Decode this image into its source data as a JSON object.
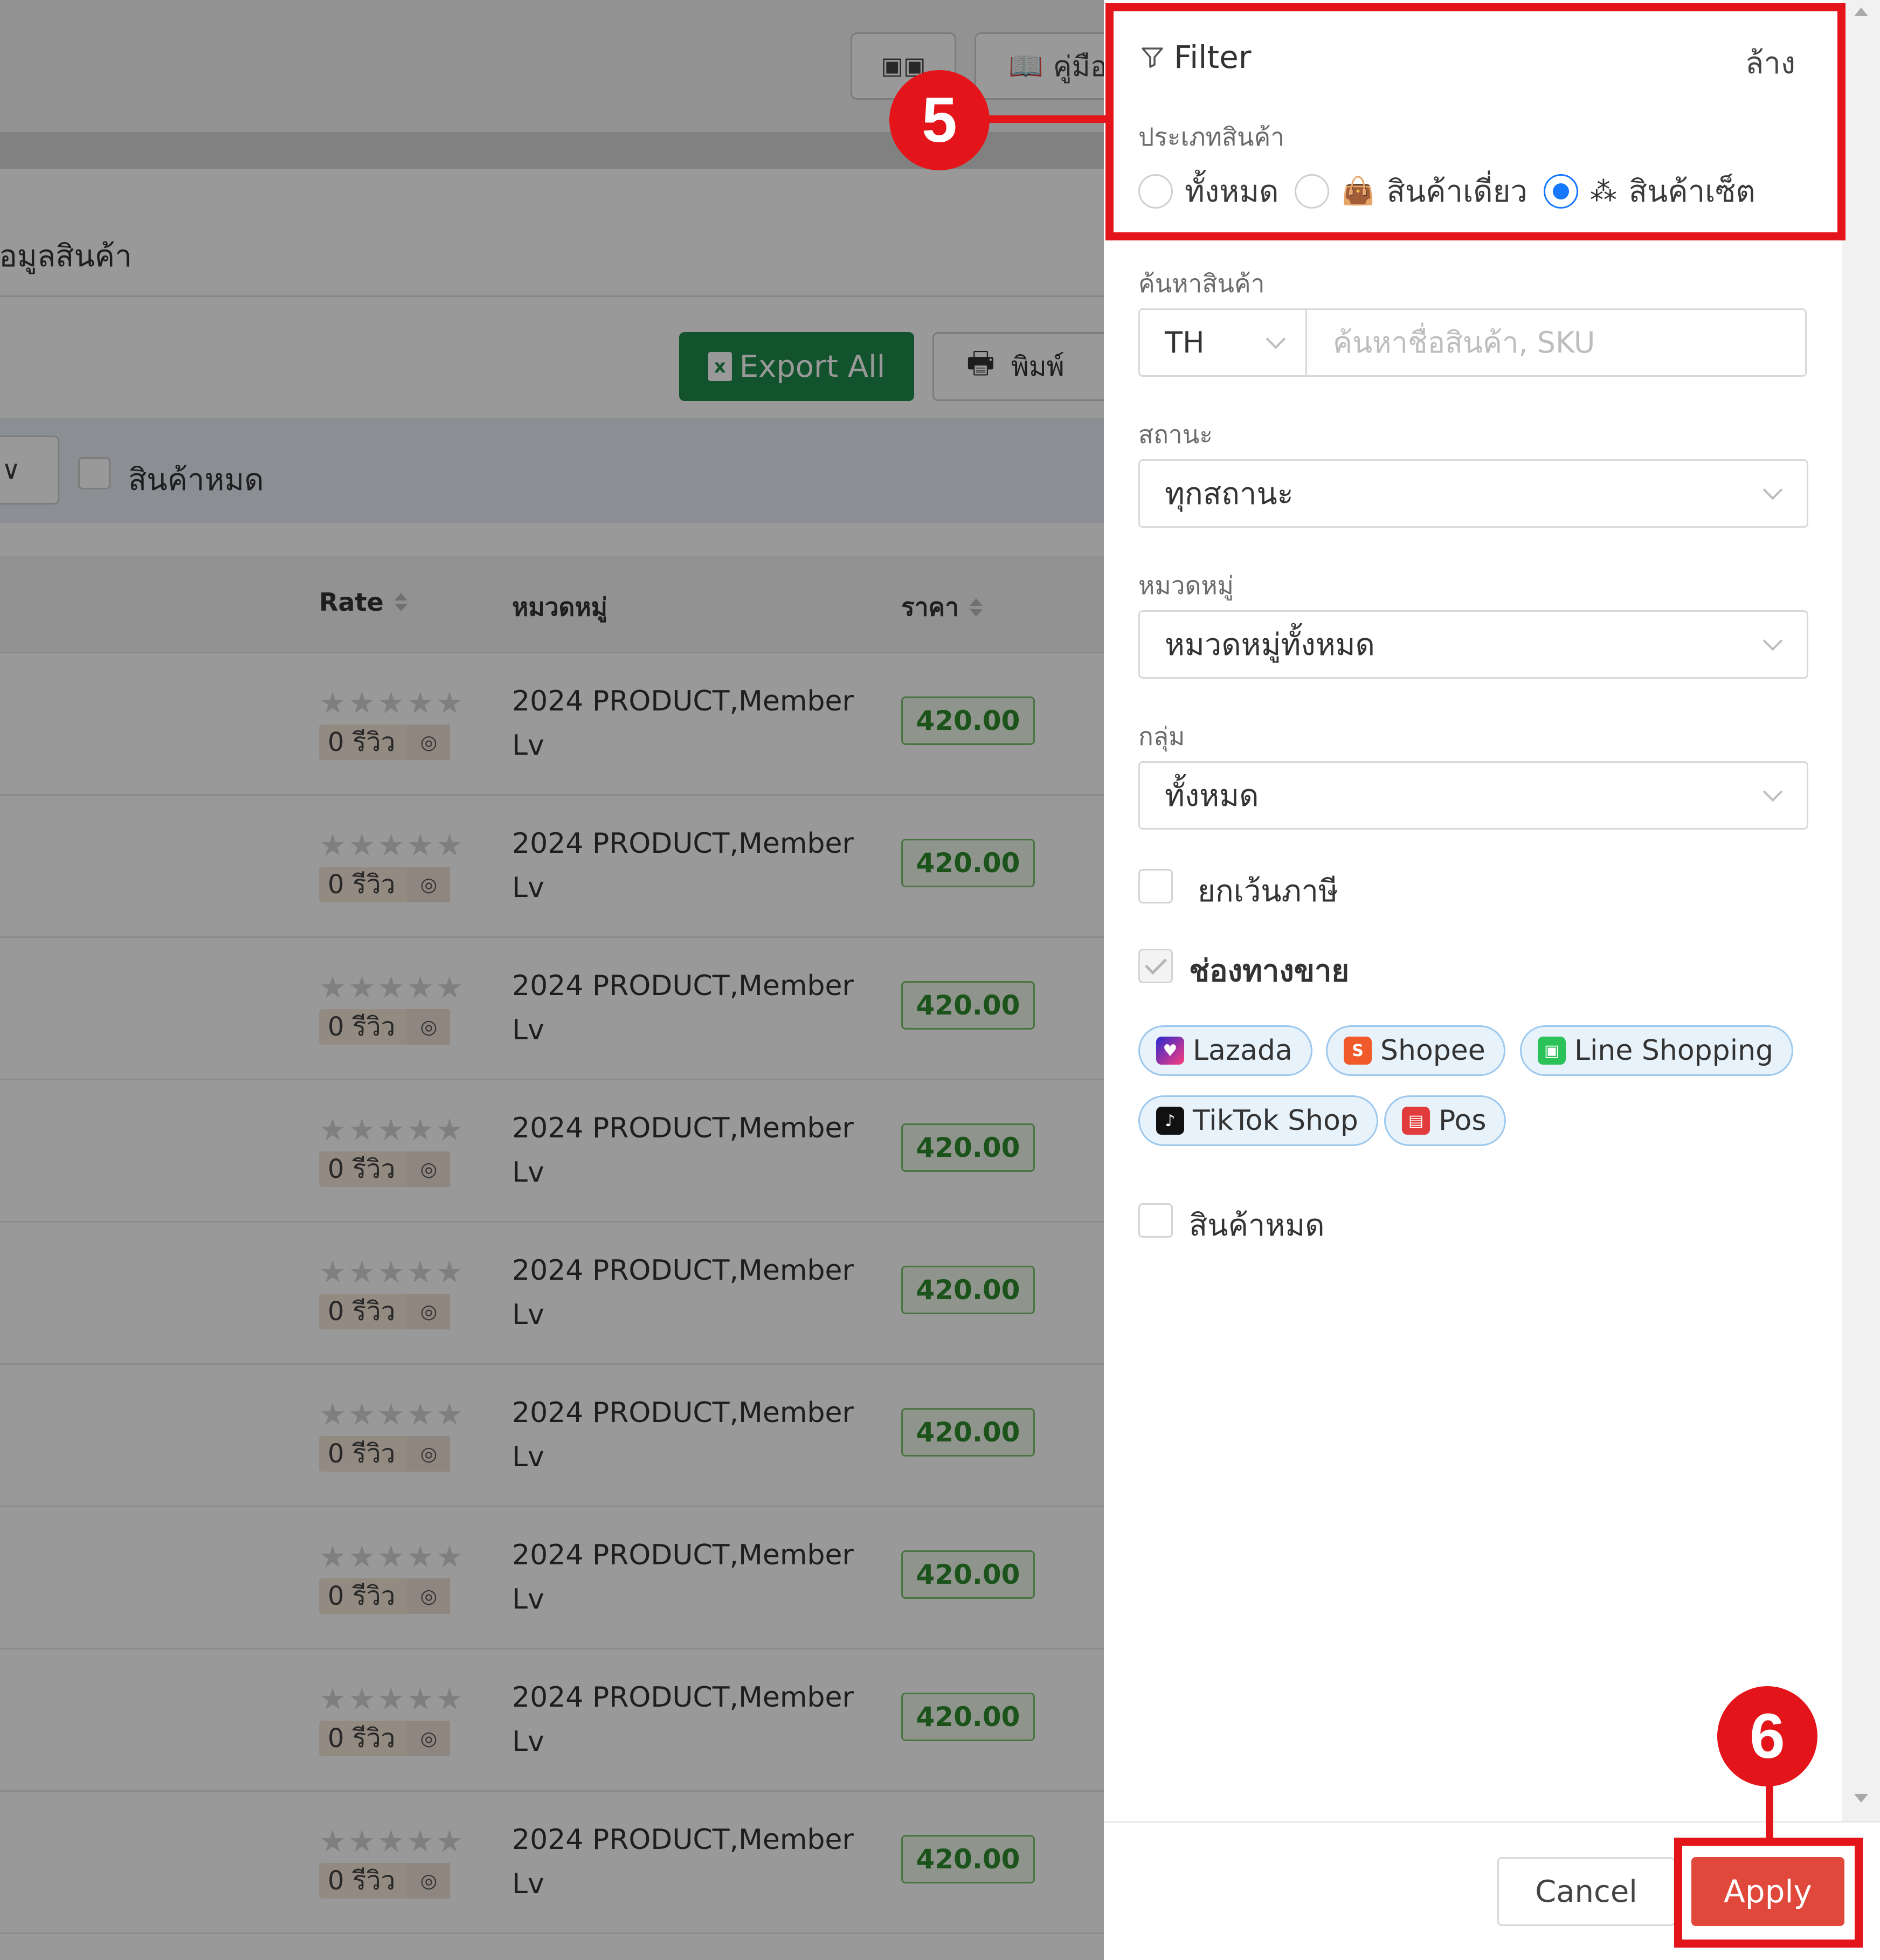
{
  "background": {
    "top_buttons": {
      "btn1_label": "",
      "guide_label": "คู่มือ"
    },
    "section_title": "ข้อมูลสินค้า",
    "export_label": "Export All",
    "print_label": "พิมพ์",
    "out_of_stock_label": "สินค้าหมด",
    "table_headers": {
      "rate": "Rate",
      "category": "หมวดหมู่",
      "price": "ราคา"
    },
    "rows": [
      {
        "reviews": "0 รีวิว",
        "category_line1": "2024 PRODUCT,Member",
        "category_line2": "Lv",
        "price": "420.00"
      },
      {
        "reviews": "0 รีวิว",
        "category_line1": "2024 PRODUCT,Member",
        "category_line2": "Lv",
        "price": "420.00"
      },
      {
        "reviews": "0 รีวิว",
        "category_line1": "2024 PRODUCT,Member",
        "category_line2": "Lv",
        "price": "420.00"
      },
      {
        "reviews": "0 รีวิว",
        "category_line1": "2024 PRODUCT,Member",
        "category_line2": "Lv",
        "price": "420.00"
      },
      {
        "reviews": "0 รีวิว",
        "category_line1": "2024 PRODUCT,Member",
        "category_line2": "Lv",
        "price": "420.00"
      },
      {
        "reviews": "0 รีวิว",
        "category_line1": "2024 PRODUCT,Member",
        "category_line2": "Lv",
        "price": "420.00"
      },
      {
        "reviews": "0 รีวิว",
        "category_line1": "2024 PRODUCT,Member",
        "category_line2": "Lv",
        "price": "420.00"
      },
      {
        "reviews": "0 รีวิว",
        "category_line1": "2024 PRODUCT,Member",
        "category_line2": "Lv",
        "price": "420.00"
      },
      {
        "reviews": "0 รีวิว",
        "category_line1": "2024 PRODUCT,Member",
        "category_line2": "Lv",
        "price": "420.00"
      }
    ]
  },
  "filter": {
    "title": "Filter",
    "clear_label": "ล้าง",
    "product_type": {
      "label": "ประเภทสินค้า",
      "options": [
        "ทั้งหมด",
        "สินค้าเดี่ยว",
        "สินค้าเซ็ต"
      ],
      "selected": "สินค้าเซ็ต"
    },
    "search": {
      "label": "ค้นหาสินค้า",
      "language": "TH",
      "placeholder": "ค้นหาชื่อสินค้า, SKU",
      "value": ""
    },
    "status": {
      "label": "สถานะ",
      "value": "ทุกสถานะ"
    },
    "category": {
      "label": "หมวดหมู่",
      "value": "หมวดหมู่ทั้งหมด"
    },
    "group": {
      "label": "กลุ่ม",
      "value": "ทั้งหมด"
    },
    "tax_exempt": {
      "label": "ยกเว้นภาษี",
      "checked": false
    },
    "channels": {
      "label": "ช่องทางขาย",
      "checked": true,
      "items": [
        "Lazada",
        "Shopee",
        "Line Shopping",
        "TikTok Shop",
        "Pos"
      ]
    },
    "out_of_stock": {
      "label": "สินค้าหมด",
      "checked": false
    },
    "cancel_label": "Cancel",
    "apply_label": "Apply"
  },
  "annotations": {
    "step_5": "5",
    "step_6": "6",
    "color": "#e3151b"
  },
  "colors": {
    "export_green": "#1f8a4c",
    "apply_red": "#e0483b",
    "radio_blue": "#1677ff",
    "price_green": "#2d8a2d"
  }
}
